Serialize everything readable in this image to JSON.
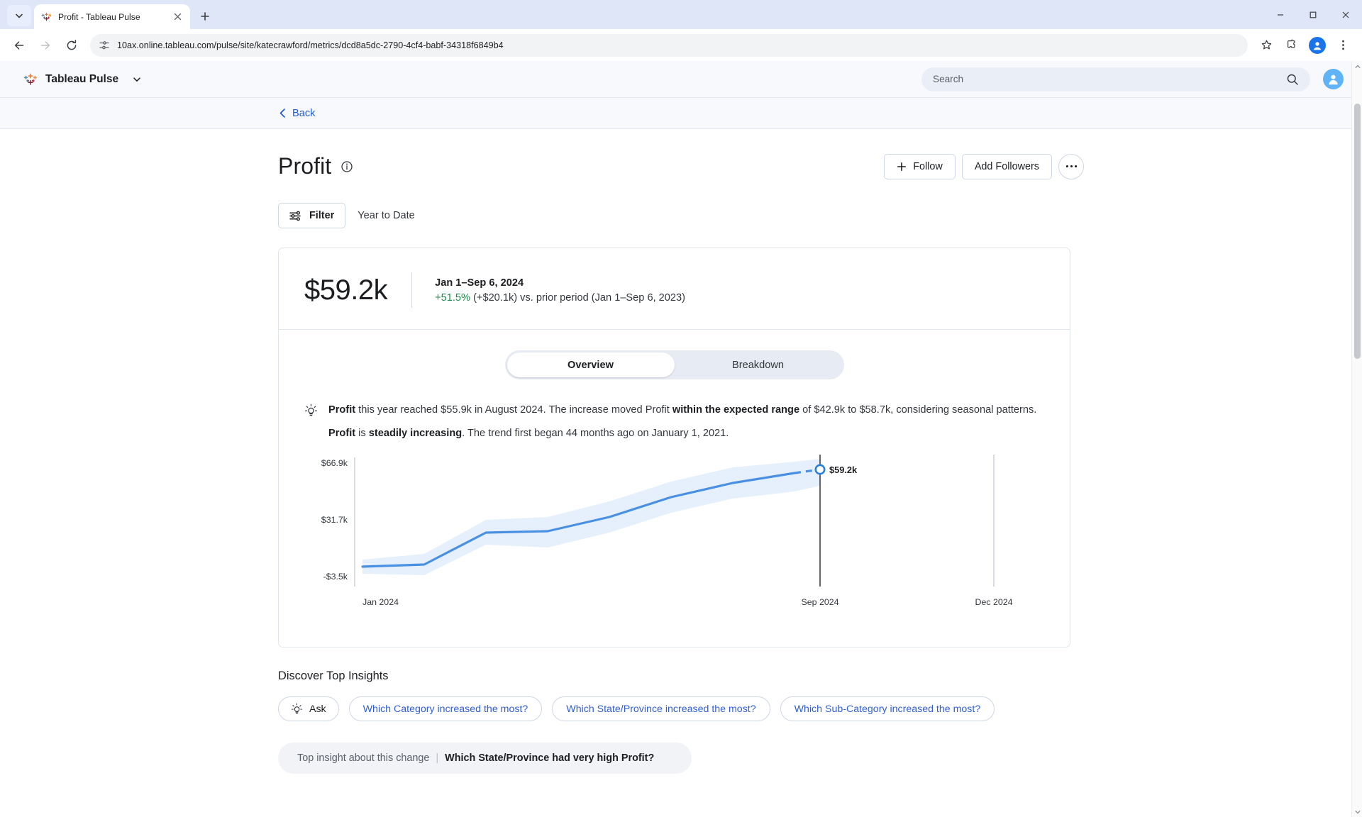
{
  "browser": {
    "tab": {
      "title": "Profit - Tableau Pulse",
      "favicon": "tableau-icon"
    },
    "new_tab_label": "+",
    "url": "10ax.online.tableau.com/pulse/site/katecrawford/metrics/dcd8a5dc-2790-4cf4-babf-34318f6849b4",
    "icons": {
      "back": "back-arrow-icon",
      "forward": "forward-arrow-icon",
      "reload": "reload-icon",
      "site_info": "site-settings-icon",
      "bookmark": "star-icon",
      "extensions": "extensions-icon",
      "profile": "profile-avatar-icon",
      "menu": "kebab-menu-icon",
      "minimize": "minimize-icon",
      "maximize": "maximize-icon",
      "close": "window-close-icon"
    }
  },
  "app": {
    "brand": "Tableau Pulse",
    "brand_caret": "chevron-down-icon",
    "search": {
      "placeholder": "Search",
      "value": "",
      "icon": "search-icon"
    },
    "avatar": "user-avatar-icon",
    "back_label": "Back"
  },
  "metric": {
    "title": "Profit",
    "info_icon": "info-circle-icon",
    "actions": {
      "follow": "Follow",
      "follow_icon": "plus-icon",
      "add_followers": "Add Followers",
      "more": "…",
      "more_icon": "ellipsis-icon"
    },
    "filter": {
      "label": "Filter",
      "icon": "filter-sliders-icon"
    },
    "date_range_label": "Year to Date",
    "kpi": {
      "value": "$59.2k",
      "period": "Jan 1–Sep 6, 2024",
      "delta_pct": "+51.5%",
      "delta_rest": " (+$20.1k) vs. prior period (Jan 1–Sep 6, 2023)"
    },
    "tabs": [
      {
        "label": "Overview",
        "active": true
      },
      {
        "label": "Breakdown",
        "active": false
      }
    ],
    "insight": {
      "icon": "lightbulb-insight-icon",
      "p1_a": "Profit",
      "p1_b": " this year reached $55.9k in August 2024. The increase moved Profit ",
      "p1_c": "within the expected range",
      "p1_d": " of $42.9k to $58.7k, considering seasonal patterns.",
      "p2_a": "Profit",
      "p2_b": " is ",
      "p2_c": "steadily increasing",
      "p2_d": ". The trend first began 44 months ago on January 1, 2021."
    }
  },
  "chart_data": {
    "type": "line",
    "title": "",
    "xlabel": "",
    "ylabel": "",
    "grid": false,
    "legend": "none",
    "y_ticks": [
      "-$3.5k",
      "$31.7k",
      "$66.9k"
    ],
    "ylim": [
      -3500,
      66900
    ],
    "x_ticks": [
      "Jan 2024",
      "Sep 2024",
      "Dec 2024"
    ],
    "x": [
      "Jan 2024",
      "Feb 2024",
      "Mar 2024",
      "Apr 2024",
      "May 2024",
      "Jun 2024",
      "Jul 2024",
      "Aug 2024",
      "Sep 2024"
    ],
    "series": [
      {
        "name": "Profit",
        "values": [
          5200,
          7400,
          20800,
          21500,
          28600,
          38400,
          47900,
          55900,
          59200
        ],
        "color": "#4a90e2",
        "dashed_from_index": 7
      },
      {
        "name": "Expected range upper",
        "values": [
          9200,
          11600,
          26500,
          27800,
          35200,
          45500,
          54600,
          58700,
          63000
        ],
        "color": "#e8f1fd"
      },
      {
        "name": "Expected range lower",
        "values": [
          1300,
          2900,
          14700,
          15700,
          22600,
          31600,
          41000,
          42900,
          46000
        ],
        "color": "#e8f1fd"
      }
    ],
    "annotations": [
      {
        "label": "$59.2k",
        "x": "Sep 2024",
        "y": 59200,
        "marker": "open-circle"
      }
    ],
    "reference_lines": [
      {
        "x": "Sep 2024",
        "style": "solid",
        "color": "#31353b"
      },
      {
        "x": "Dec 2024",
        "style": "solid",
        "color": "#c9ced6"
      }
    ]
  },
  "discover": {
    "heading": "Discover Top Insights",
    "ask": {
      "label": "Ask",
      "icon": "lightbulb-ask-icon"
    },
    "questions": [
      "Which Category increased the most?",
      "Which State/Province increased the most?",
      "Which Sub-Category increased the most?"
    ]
  },
  "bottom_chip": {
    "prefix": "Top insight about this change",
    "divider": "|",
    "question": "Which State/Province had very high Profit?"
  }
}
